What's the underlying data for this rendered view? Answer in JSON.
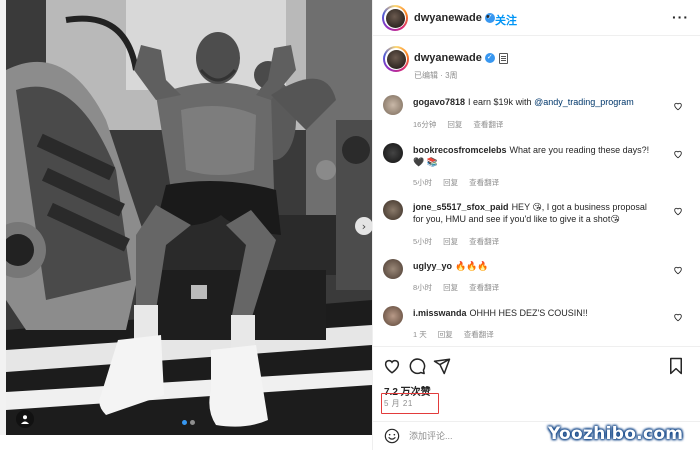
{
  "post": {
    "username": "dwyanewade",
    "follow_separator": "•",
    "follow_label": "关注",
    "more_icon": "more-horizontal-icon"
  },
  "caption": {
    "username": "dwyanewade",
    "meta": "已编辑 · 3周"
  },
  "comments": [
    {
      "user": "gogavo7818",
      "text_pre": "I earn $19k with ",
      "link": "@andy_trading_program",
      "time": "16分钟",
      "reply": "回复",
      "translate": "查看翻译"
    },
    {
      "user": "bookrecosfromcelebs",
      "text": "What are you reading these days?! 🖤 📚",
      "time": "5小时",
      "reply": "回复",
      "translate": "查看翻译"
    },
    {
      "user": "jone_s5517_sfox_paid",
      "text": "HEY 😘, I got a business proposal for you, HMU and see if you'd like to give it a shot😘",
      "time": "5小时",
      "reply": "回复",
      "translate": "查看翻译"
    },
    {
      "user": "uglyy_yo",
      "text": "🔥🔥🔥",
      "time": "8小时",
      "reply": "回复",
      "translate": "查看翻译"
    },
    {
      "user": "i.misswanda",
      "text": "OHHH HES DEZ'S COUSIN!!",
      "time": "1 天",
      "reply": "回复",
      "translate": "查看翻译"
    }
  ],
  "actions": {
    "like_icon": "heart-icon",
    "comment_icon": "comment-icon",
    "share_icon": "send-icon",
    "save_icon": "bookmark-icon"
  },
  "likes_label": "7.2 万次赞",
  "date_label": "5 月 21",
  "add_comment": {
    "placeholder": "添加评论...",
    "emoji_icon": "emoji-icon"
  },
  "watermark": "Yoozhibo.com",
  "colors": {
    "link": "#00376b",
    "follow": "#0095f6",
    "verified": "#3897f0",
    "highlight_box": "#e23b3b",
    "muted": "#8e8e8e"
  }
}
